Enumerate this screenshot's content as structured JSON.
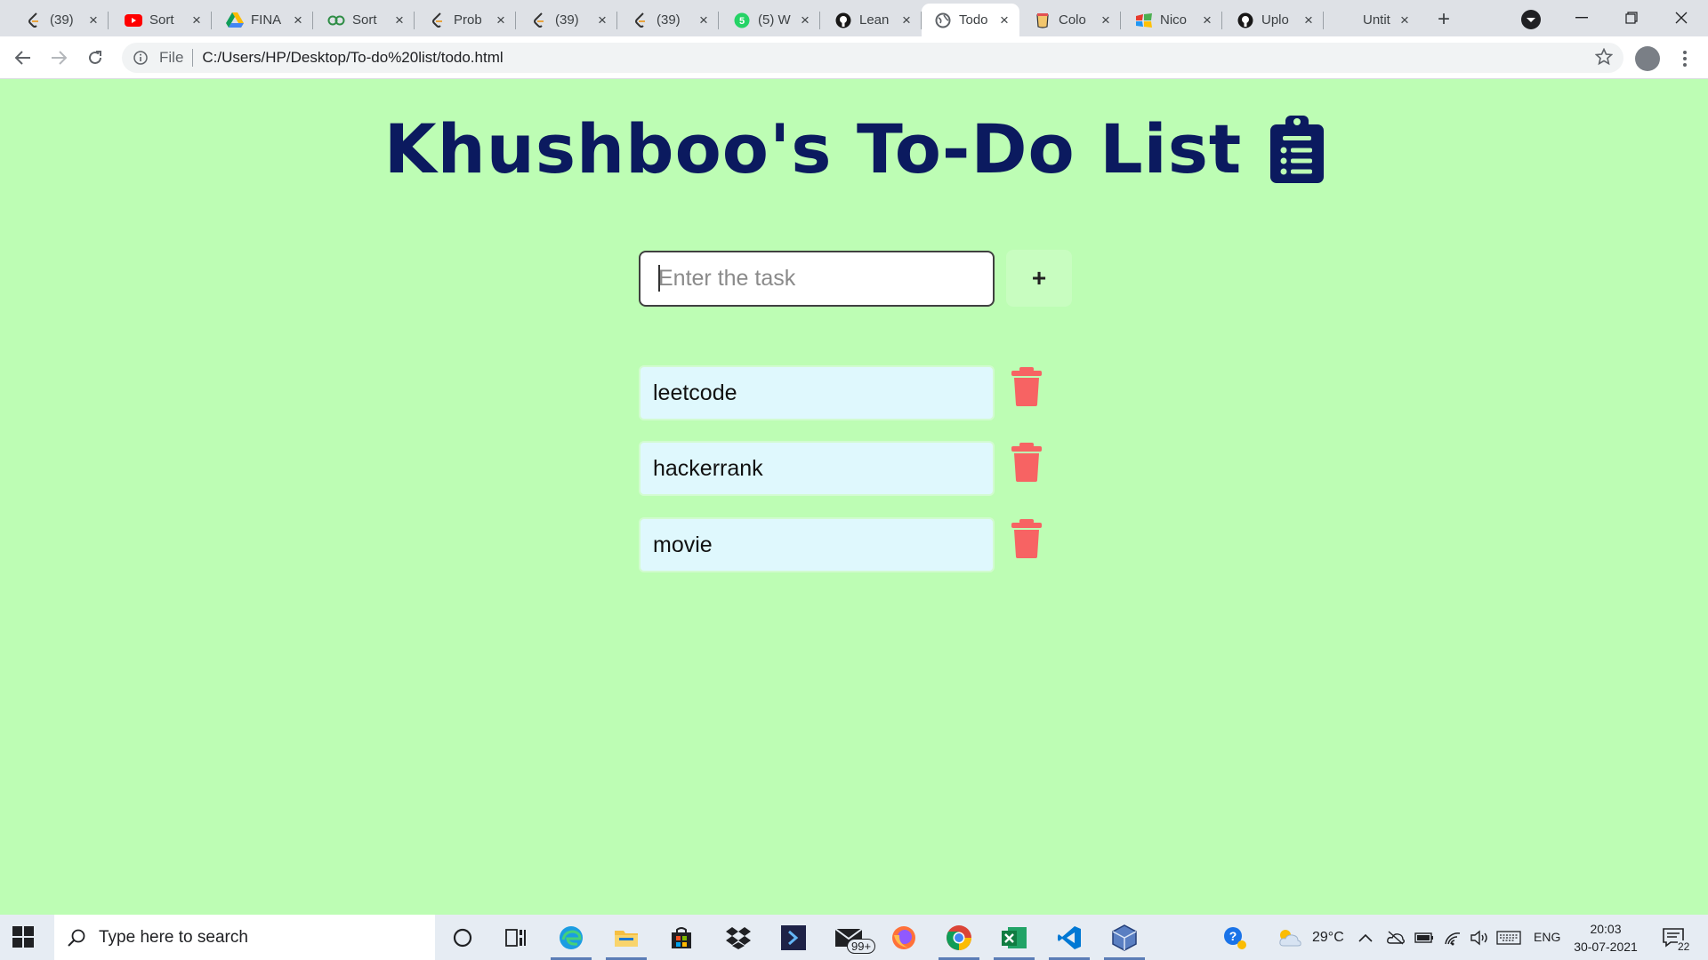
{
  "browser": {
    "tabs": [
      {
        "title": "(39)",
        "icon": "leetcode-icon"
      },
      {
        "title": "Sort",
        "icon": "youtube-icon"
      },
      {
        "title": "FINA",
        "icon": "google-drive-icon"
      },
      {
        "title": "Sort",
        "icon": "geeksforgeeks-icon"
      },
      {
        "title": "Prob",
        "icon": "leetcode-icon"
      },
      {
        "title": "(39)",
        "icon": "leetcode-icon"
      },
      {
        "title": "(39)",
        "icon": "leetcode-icon"
      },
      {
        "title": "(5) W",
        "icon": "whatsapp-icon"
      },
      {
        "title": "Lean",
        "icon": "github-icon"
      },
      {
        "title": "Todo",
        "icon": "globe-icon"
      },
      {
        "title": "Colo",
        "icon": "colorhunt-icon"
      },
      {
        "title": "Nico",
        "icon": "windows-color-icon"
      },
      {
        "title": "Uplo",
        "icon": "github-icon"
      },
      {
        "title": "Untit",
        "icon": "blank-icon"
      }
    ],
    "active_tab_index": 9,
    "address": {
      "scheme": "File",
      "url": "C:/Users/HP/Desktop/To-do%20list/todo.html"
    }
  },
  "page": {
    "title": "Khushboo's To-Do List",
    "input": {
      "placeholder": "Enter the task",
      "value": ""
    },
    "add_button_label": "+",
    "tasks": [
      "leetcode",
      "hackerrank",
      "movie"
    ]
  },
  "taskbar": {
    "search_placeholder": "Type here to search",
    "mail_badge": "99+",
    "weather": "29°C",
    "language": "ENG",
    "time": "20:03",
    "date": "30-07-2021",
    "notification_count": "22"
  },
  "colors": {
    "page_background": "#bdfdb4",
    "heading": "#0b1a5f",
    "task_background": "#dff8fd",
    "trash": "#f76363"
  }
}
